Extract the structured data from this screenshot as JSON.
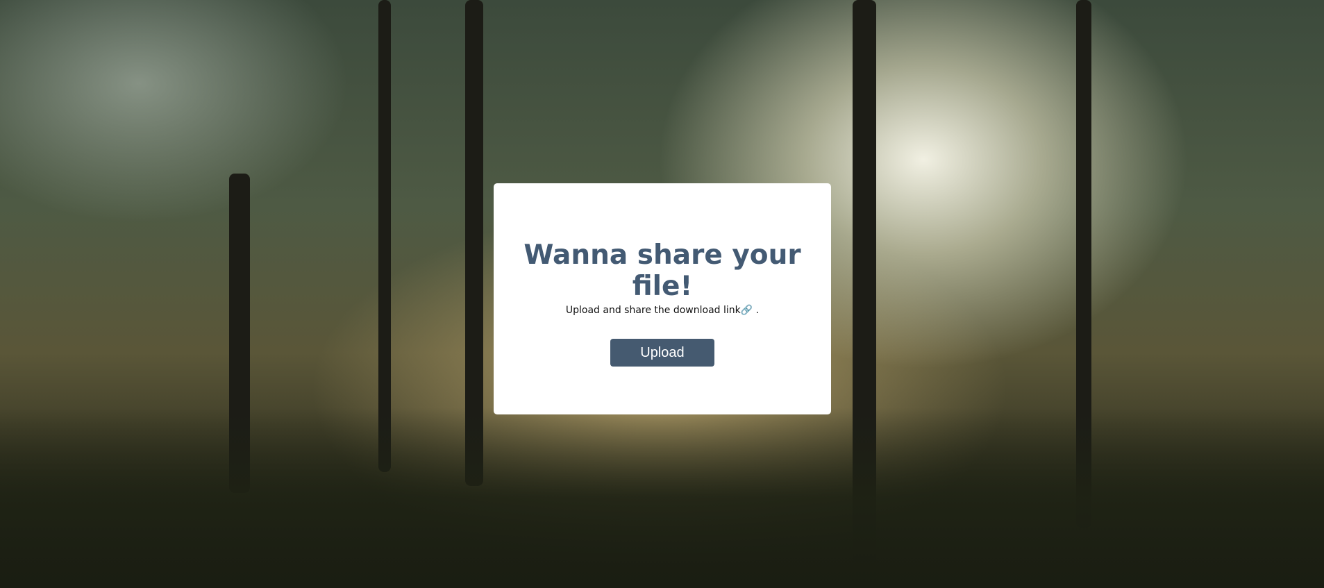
{
  "card": {
    "title": "Wanna share your file!",
    "subtitle": "Upload and share the download link",
    "link_icon": "🔗",
    "subtitle_suffix": " .",
    "upload_label": "Upload"
  },
  "colors": {
    "accent": "#455a70",
    "title": "#435a73"
  },
  "background": "forest-photo"
}
